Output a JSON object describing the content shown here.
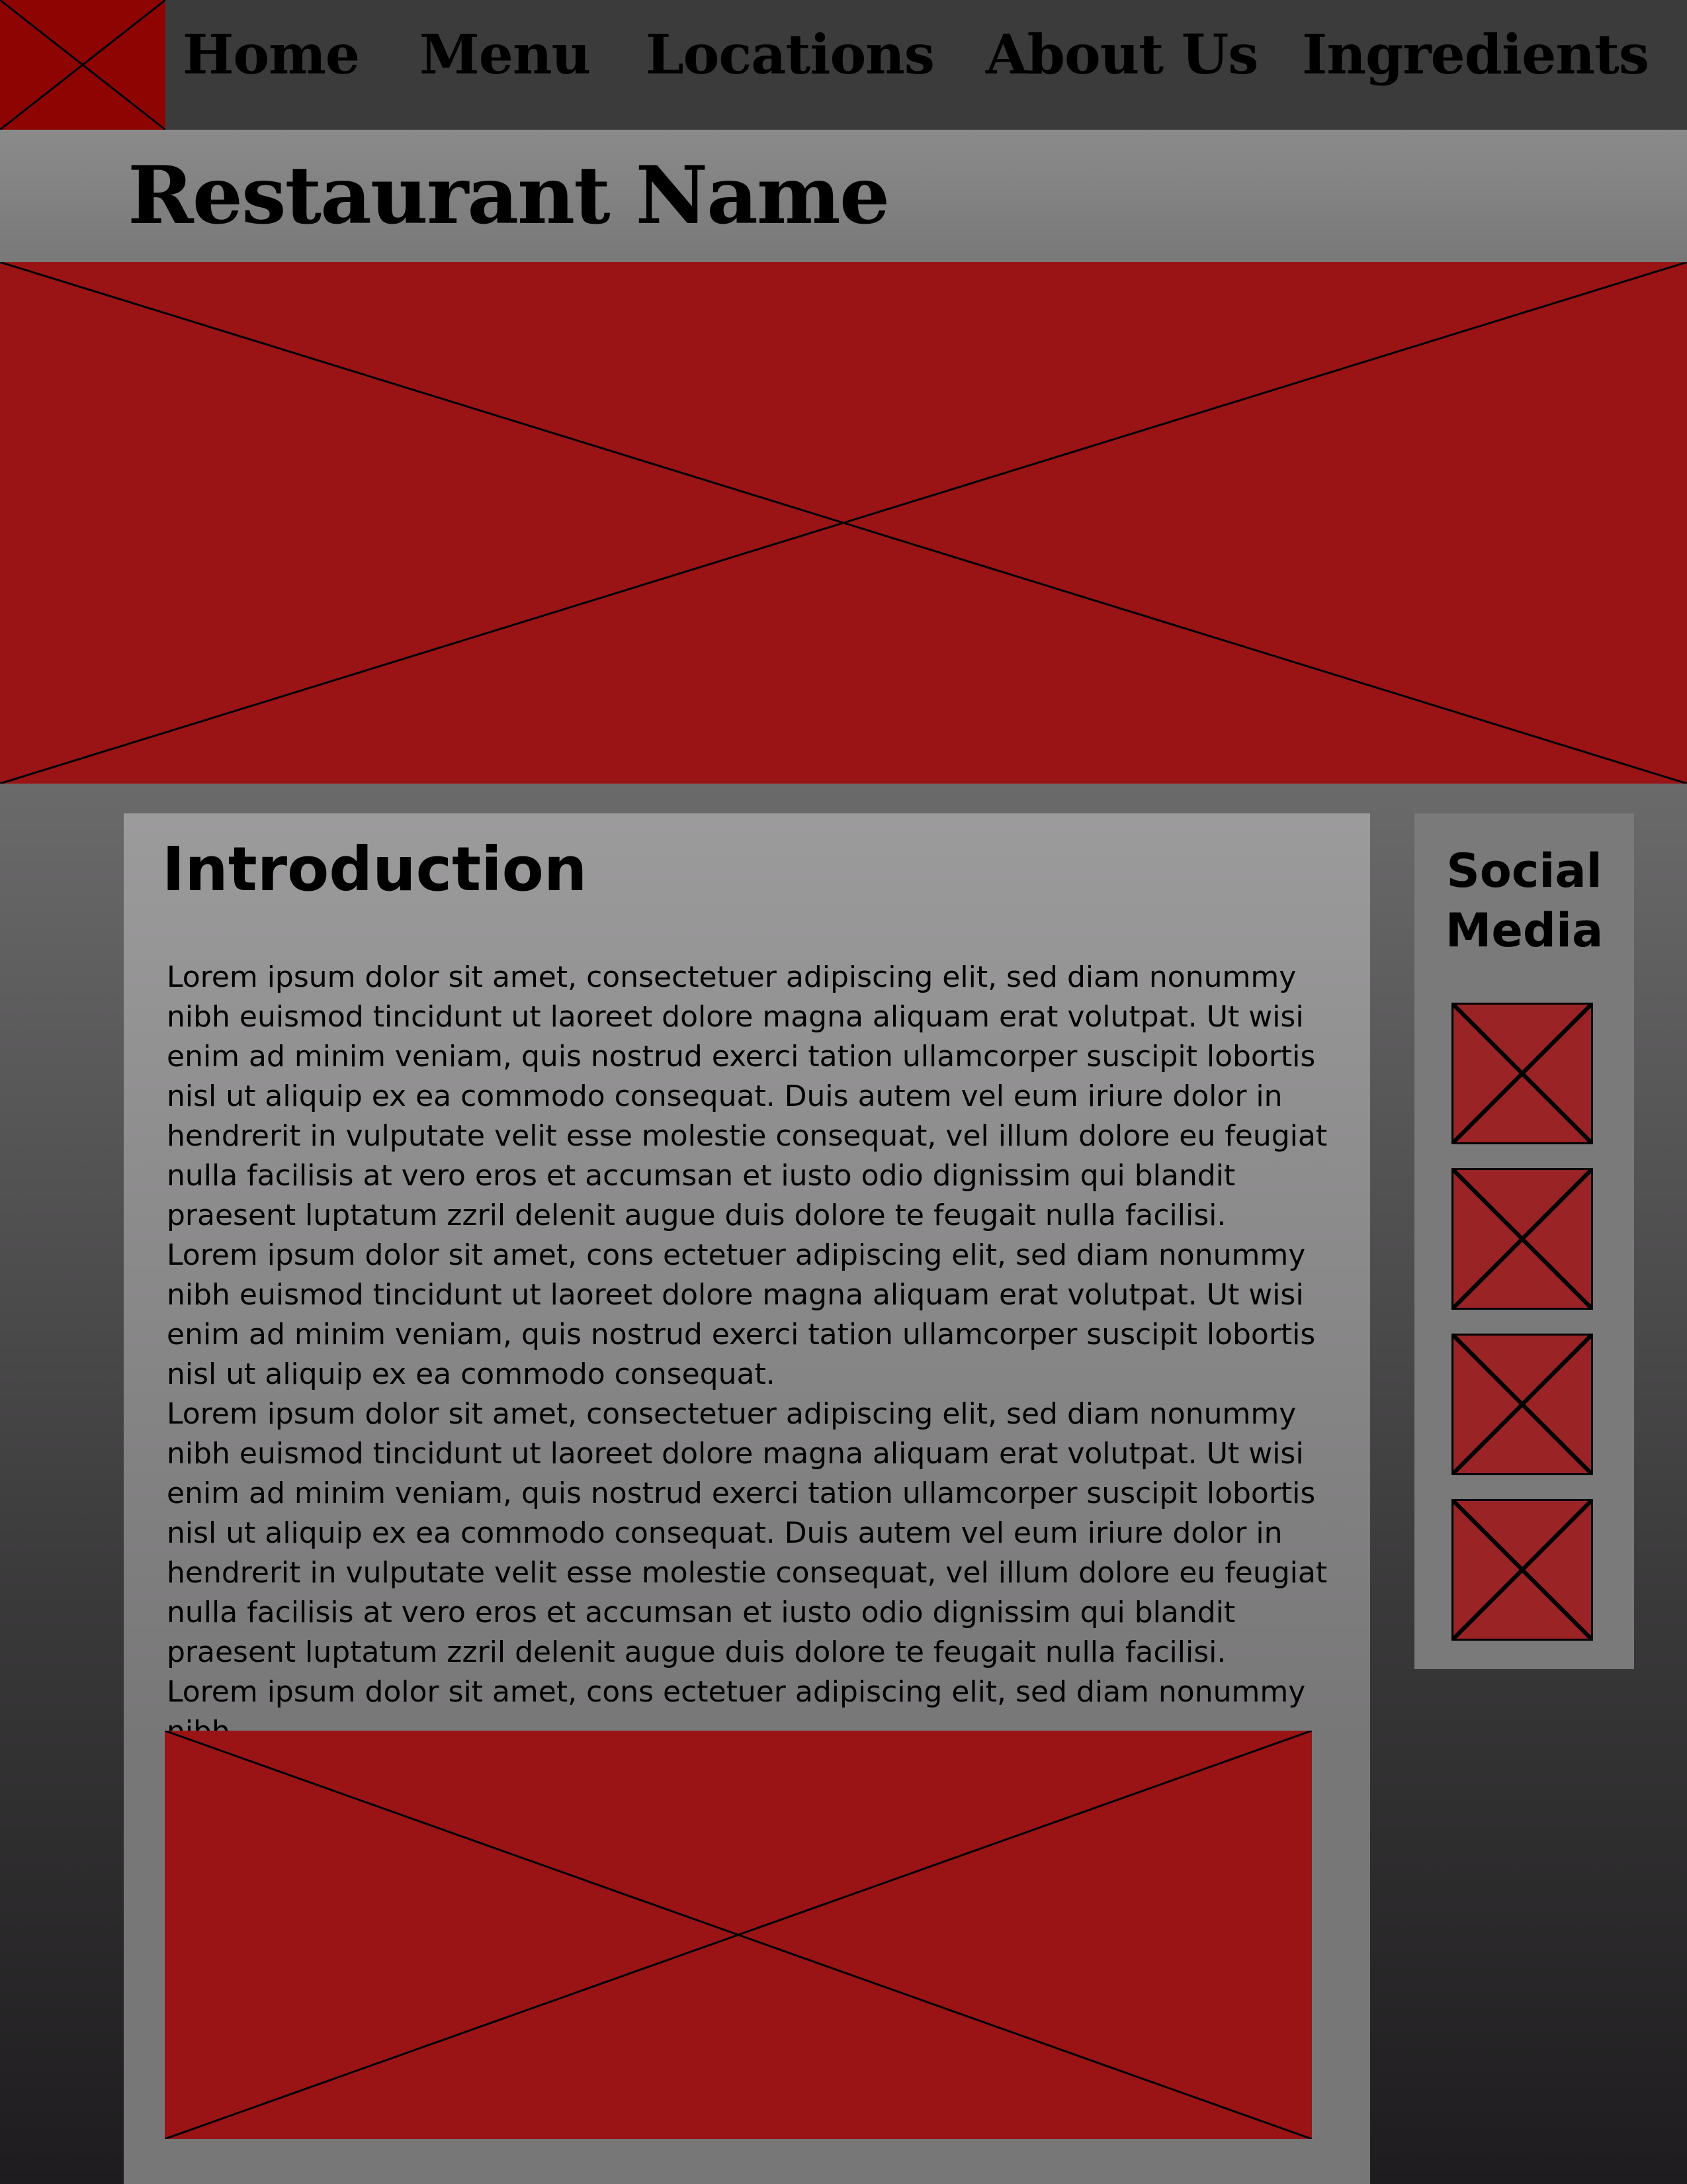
{
  "nav": {
    "logo_icon": "placeholder-image-icon",
    "items": [
      "Home",
      "Menu",
      "Locations",
      "About Us",
      "Ingredients"
    ]
  },
  "header": {
    "title": "Restaurant Name"
  },
  "hero": {
    "icon": "placeholder-image-icon"
  },
  "main": {
    "heading": "Introduction",
    "paragraphs": [
      "Lorem ipsum dolor sit amet, consectetuer adipiscing elit, sed diam nonummy nibh euismod tincidunt ut laoreet dolore magna aliquam erat volutpat. Ut wisi enim ad minim veniam, quis nostrud exerci tation ullamcorper suscipit lobortis nisl ut aliquip ex ea commodo consequat. Duis autem vel eum iriure dolor in hendrerit in vulputate velit esse molestie consequat, vel illum dolore eu feugiat nulla facilisis at vero eros et accumsan et iusto odio dignissim qui blandit praesent luptatum zzril delenit augue duis dolore te feugait nulla facilisi.",
      "Lorem ipsum dolor sit amet, cons ectetuer adipiscing elit, sed diam nonummy nibh euismod tincidunt ut laoreet dolore magna aliquam erat volutpat. Ut wisi enim ad minim veniam, quis nostrud exerci tation ullamcorper suscipit lobortis nisl ut aliquip ex ea commodo consequat.",
      "Lorem ipsum dolor sit amet, consectetuer adipiscing elit, sed diam nonummy nibh euismod tincidunt ut laoreet dolore magna aliquam erat volutpat. Ut wisi enim ad minim veniam, quis nostrud exerci tation ullamcorper suscipit lobortis nisl ut aliquip ex ea commodo consequat. Duis autem vel eum iriure dolor in hendrerit in vulputate velit esse molestie consequat, vel illum dolore eu feugiat nulla facilisis at vero eros et accumsan et iusto odio dignissim qui blandit praesent luptatum zzril delenit augue duis dolore te feugait nulla facilisi.",
      "Lorem ipsum dolor sit amet, cons ectetuer adipiscing elit, sed diam nonummy nibh"
    ],
    "image_icon": "placeholder-image-icon"
  },
  "social": {
    "heading": "Social Media",
    "icons": [
      "social-placeholder-icon",
      "social-placeholder-icon",
      "social-placeholder-icon",
      "social-placeholder-icon"
    ]
  },
  "colors": {
    "placeholder_red": "#9a1416",
    "logo_red": "#8d0403",
    "nav_bg": "#3b3b3c",
    "panel_gray": "#8a898a"
  }
}
